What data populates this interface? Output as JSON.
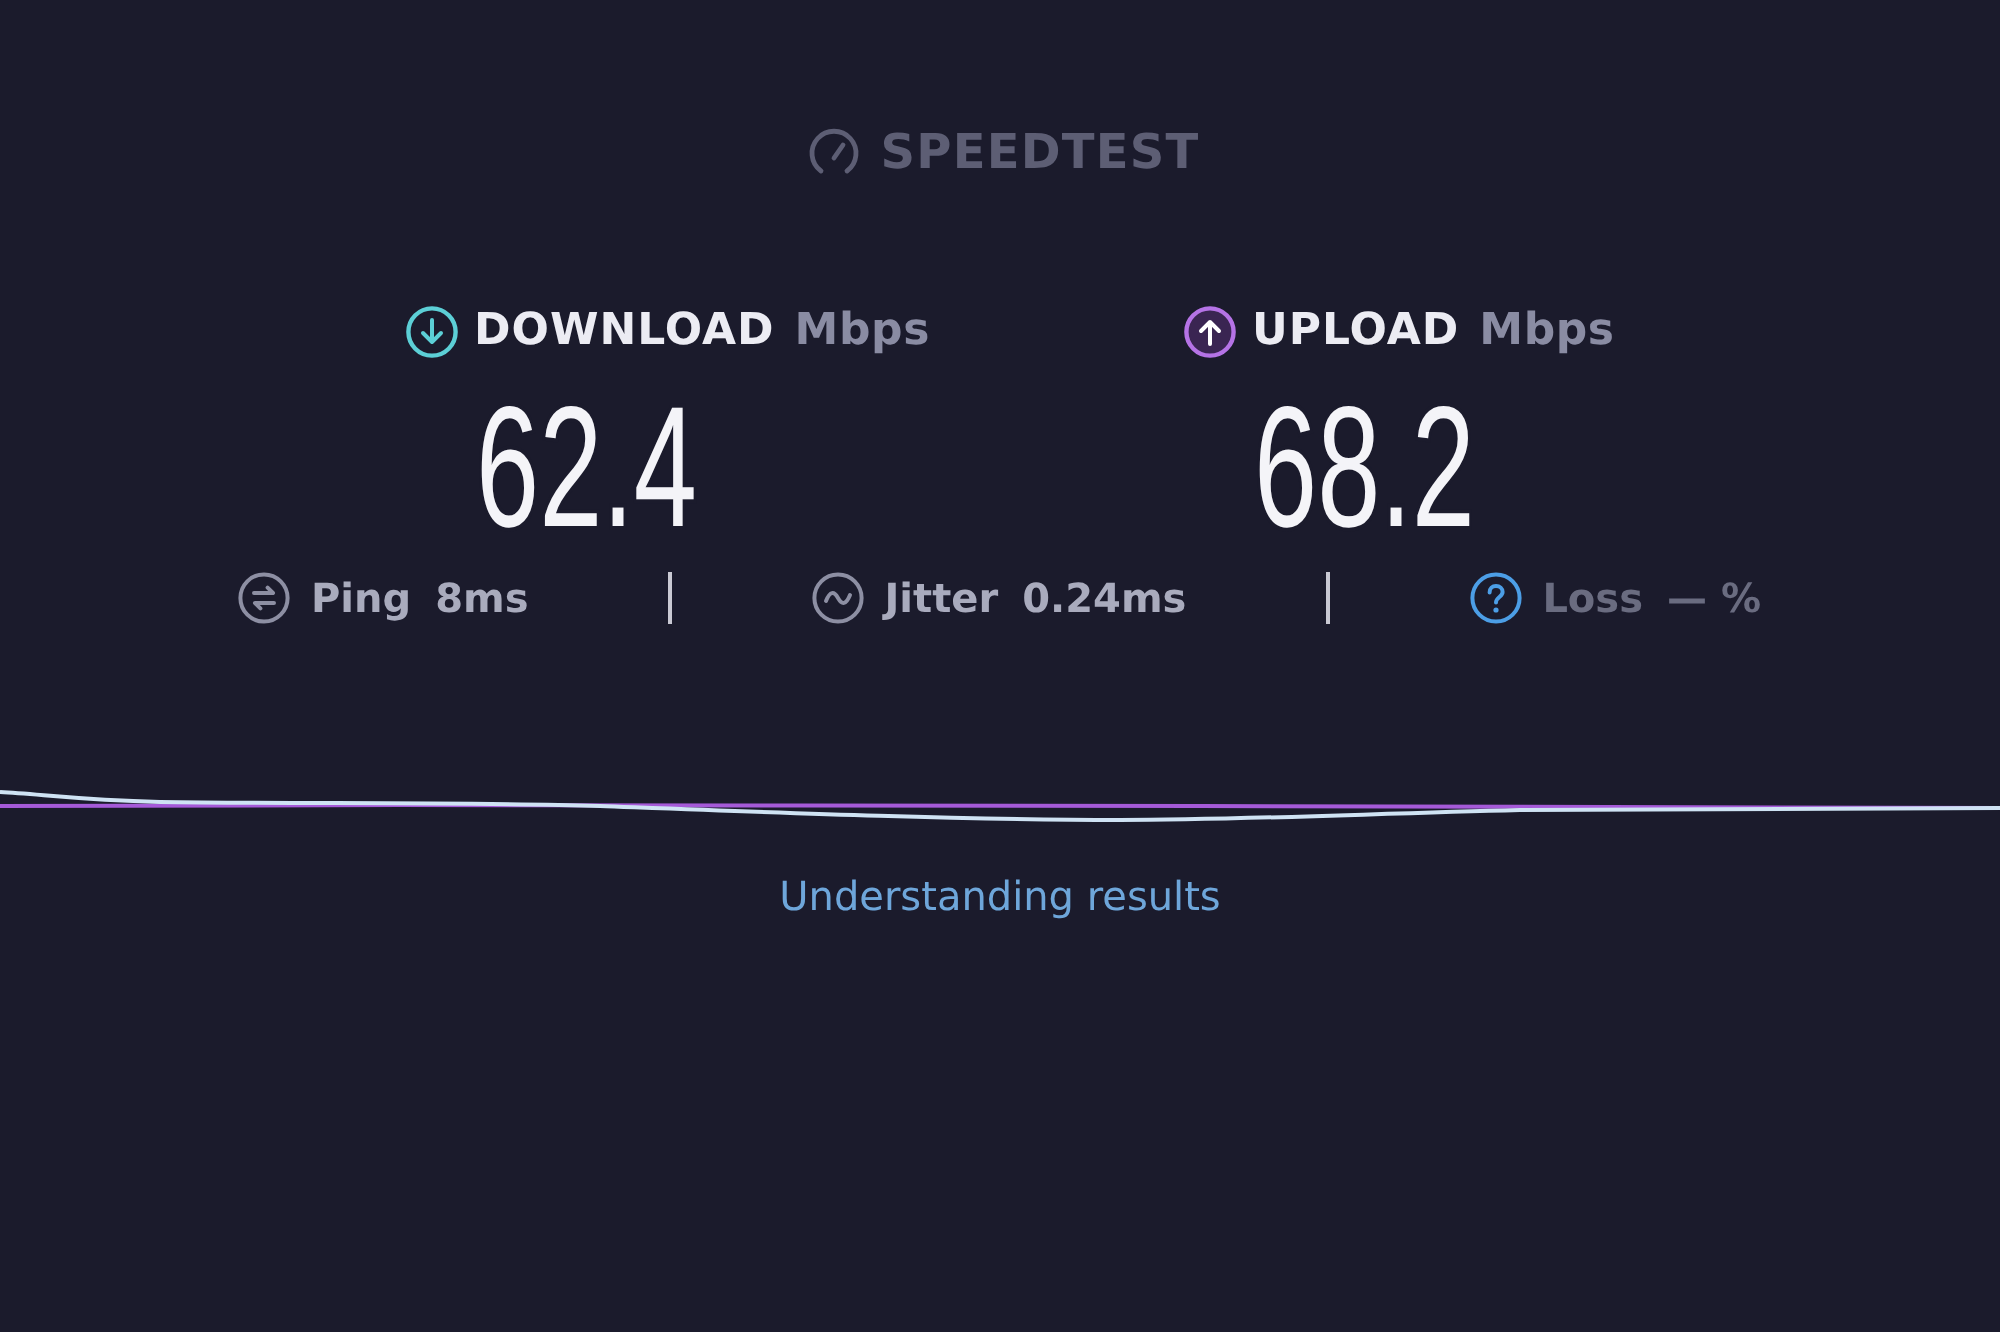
{
  "logo": {
    "text": "SPEEDTEST"
  },
  "results": [
    {
      "kind": "download",
      "label": "DOWNLOAD",
      "unit": "Mbps",
      "value": "62.4",
      "color": "#5ccfd6"
    },
    {
      "kind": "upload",
      "label": "UPLOAD",
      "unit": "Mbps",
      "value": "68.2",
      "color": "#b573e6"
    }
  ],
  "stats": [
    {
      "kind": "ping",
      "label": "Ping",
      "value": "8ms",
      "disabled": false
    },
    {
      "kind": "jitter",
      "label": "Jitter",
      "value": "0.24ms",
      "disabled": false
    },
    {
      "kind": "loss",
      "label": "Loss",
      "value": "— %",
      "disabled": true
    }
  ],
  "link": "Understanding results"
}
